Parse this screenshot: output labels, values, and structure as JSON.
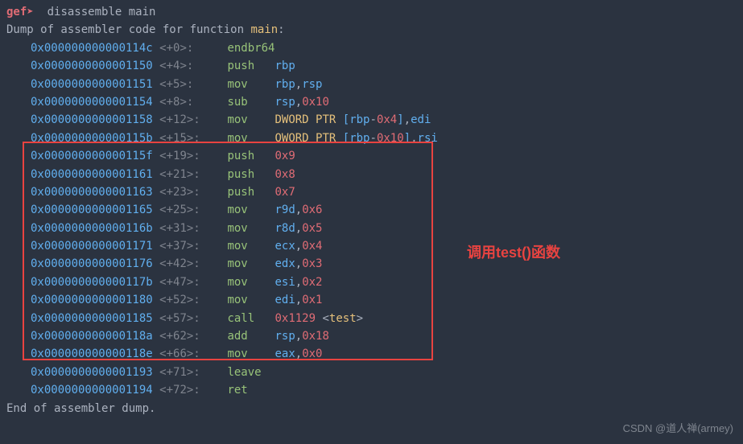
{
  "prompt": {
    "name": "gef",
    "arrow": "➤",
    "command": "disassemble main"
  },
  "dump_header_prefix": "Dump of assembler code for function ",
  "dump_header_func": "main",
  "dump_header_suffix": ":",
  "dump_footer": "End of assembler dump.",
  "rows": [
    {
      "addr": "0x000000000000114c",
      "off": "<+0>:",
      "mn": "endbr64",
      "ops": []
    },
    {
      "addr": "0x0000000000001150",
      "off": "<+4>:",
      "mn": "push",
      "ops": [
        {
          "t": "rbp",
          "c": "blue"
        }
      ]
    },
    {
      "addr": "0x0000000000001151",
      "off": "<+5>:",
      "mn": "mov",
      "ops": [
        {
          "t": "rbp",
          "c": "blue"
        },
        {
          "t": ",",
          "c": "gray"
        },
        {
          "t": "rsp",
          "c": "blue"
        }
      ]
    },
    {
      "addr": "0x0000000000001154",
      "off": "<+8>:",
      "mn": "sub",
      "ops": [
        {
          "t": "rsp",
          "c": "blue"
        },
        {
          "t": ",",
          "c": "gray"
        },
        {
          "t": "0x10",
          "c": "red"
        }
      ]
    },
    {
      "addr": "0x0000000000001158",
      "off": "<+12>:",
      "mn": "mov",
      "ops": [
        {
          "t": "DWORD PTR ",
          "c": "yellow"
        },
        {
          "t": "[",
          "c": "blue"
        },
        {
          "t": "rbp",
          "c": "blue"
        },
        {
          "t": "-",
          "c": "gray"
        },
        {
          "t": "0x4",
          "c": "red"
        },
        {
          "t": "]",
          "c": "blue"
        },
        {
          "t": ",",
          "c": "gray"
        },
        {
          "t": "edi",
          "c": "blue"
        }
      ]
    },
    {
      "addr": "0x000000000000115b",
      "off": "<+15>:",
      "mn": "mov",
      "ops": [
        {
          "t": "QWORD PTR ",
          "c": "yellow"
        },
        {
          "t": "[",
          "c": "blue"
        },
        {
          "t": "rbp",
          "c": "blue"
        },
        {
          "t": "-",
          "c": "gray"
        },
        {
          "t": "0x10",
          "c": "red"
        },
        {
          "t": "]",
          "c": "blue"
        },
        {
          "t": ",",
          "c": "gray"
        },
        {
          "t": "rsi",
          "c": "blue"
        }
      ]
    },
    {
      "addr": "0x000000000000115f",
      "off": "<+19>:",
      "mn": "push",
      "ops": [
        {
          "t": "0x9",
          "c": "red"
        }
      ]
    },
    {
      "addr": "0x0000000000001161",
      "off": "<+21>:",
      "mn": "push",
      "ops": [
        {
          "t": "0x8",
          "c": "red"
        }
      ]
    },
    {
      "addr": "0x0000000000001163",
      "off": "<+23>:",
      "mn": "push",
      "ops": [
        {
          "t": "0x7",
          "c": "red"
        }
      ]
    },
    {
      "addr": "0x0000000000001165",
      "off": "<+25>:",
      "mn": "mov",
      "ops": [
        {
          "t": "r9d",
          "c": "blue"
        },
        {
          "t": ",",
          "c": "gray"
        },
        {
          "t": "0x6",
          "c": "red"
        }
      ]
    },
    {
      "addr": "0x000000000000116b",
      "off": "<+31>:",
      "mn": "mov",
      "ops": [
        {
          "t": "r8d",
          "c": "blue"
        },
        {
          "t": ",",
          "c": "gray"
        },
        {
          "t": "0x5",
          "c": "red"
        }
      ]
    },
    {
      "addr": "0x0000000000001171",
      "off": "<+37>:",
      "mn": "mov",
      "ops": [
        {
          "t": "ecx",
          "c": "blue"
        },
        {
          "t": ",",
          "c": "gray"
        },
        {
          "t": "0x4",
          "c": "red"
        }
      ]
    },
    {
      "addr": "0x0000000000001176",
      "off": "<+42>:",
      "mn": "mov",
      "ops": [
        {
          "t": "edx",
          "c": "blue"
        },
        {
          "t": ",",
          "c": "gray"
        },
        {
          "t": "0x3",
          "c": "red"
        }
      ]
    },
    {
      "addr": "0x000000000000117b",
      "off": "<+47>:",
      "mn": "mov",
      "ops": [
        {
          "t": "esi",
          "c": "blue"
        },
        {
          "t": ",",
          "c": "gray"
        },
        {
          "t": "0x2",
          "c": "red"
        }
      ]
    },
    {
      "addr": "0x0000000000001180",
      "off": "<+52>:",
      "mn": "mov",
      "ops": [
        {
          "t": "edi",
          "c": "blue"
        },
        {
          "t": ",",
          "c": "gray"
        },
        {
          "t": "0x1",
          "c": "red"
        }
      ]
    },
    {
      "addr": "0x0000000000001185",
      "off": "<+57>:",
      "mn": "call",
      "ops": [
        {
          "t": "0x1129",
          "c": "red"
        },
        {
          "t": " <",
          "c": "gray"
        },
        {
          "t": "test",
          "c": "yellow"
        },
        {
          "t": ">",
          "c": "gray"
        }
      ]
    },
    {
      "addr": "0x000000000000118a",
      "off": "<+62>:",
      "mn": "add",
      "ops": [
        {
          "t": "rsp",
          "c": "blue"
        },
        {
          "t": ",",
          "c": "gray"
        },
        {
          "t": "0x18",
          "c": "red"
        }
      ]
    },
    {
      "addr": "0x000000000000118e",
      "off": "<+66>:",
      "mn": "mov",
      "ops": [
        {
          "t": "eax",
          "c": "blue"
        },
        {
          "t": ",",
          "c": "gray"
        },
        {
          "t": "0x0",
          "c": "red"
        }
      ]
    },
    {
      "addr": "0x0000000000001193",
      "off": "<+71>:",
      "mn": "leave",
      "ops": []
    },
    {
      "addr": "0x0000000000001194",
      "off": "<+72>:",
      "mn": "ret",
      "ops": []
    }
  ],
  "annotation": "调用test()函数",
  "watermark": "CSDN @道人禅(armey)"
}
